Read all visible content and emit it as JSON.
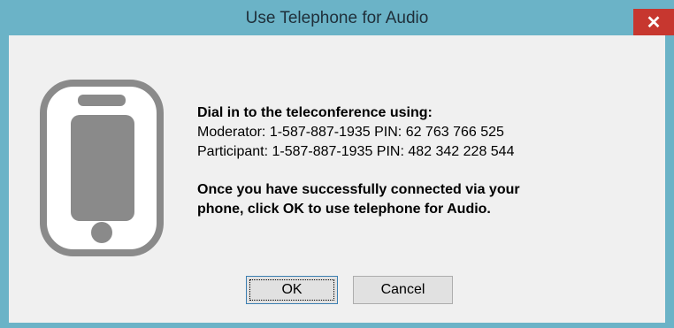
{
  "window": {
    "title": "Use Telephone for Audio",
    "close_glyph": "✕"
  },
  "message": {
    "heading": "Dial in to the teleconference using:",
    "moderator": "Moderator: 1-587-887-1935 PIN: 62 763 766 525",
    "participant": "Participant: 1-587-887-1935 PIN: 482 342 228 544",
    "instruction_line1": "Once you have successfully connected via your",
    "instruction_line2": "phone, click OK to use telephone for Audio."
  },
  "buttons": {
    "ok_label": "OK",
    "cancel_label": "Cancel"
  },
  "icons": {
    "phone": "mobile-phone-icon"
  },
  "colors": {
    "titlebar": "#6bb3c7",
    "close_button": "#c7372f",
    "client_background": "#f0f0f0",
    "phone_icon": "#8a8a8a"
  }
}
